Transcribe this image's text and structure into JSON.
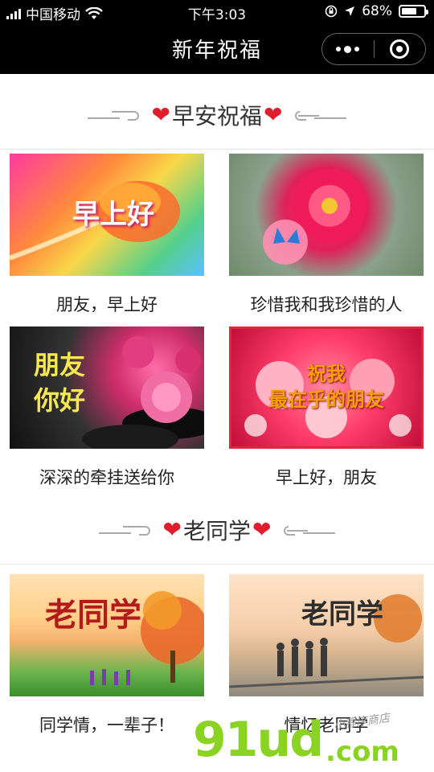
{
  "status_bar": {
    "carrier": "中国移动",
    "time": "下午3:03",
    "battery_percent": "68%",
    "battery_level": 0.68
  },
  "nav": {
    "title": "新年祝福"
  },
  "sections": [
    {
      "title": "早安祝福",
      "cards": [
        {
          "caption": "朋友，早上好",
          "image_text": "早上好"
        },
        {
          "caption": "珍惜我和我珍惜的人",
          "image_text": ""
        },
        {
          "caption": "深深的牵挂送给你",
          "image_text": "朋友\n你好"
        },
        {
          "caption": "早上好，朋友",
          "image_text": "祝我\n最在乎的朋友"
        }
      ]
    },
    {
      "title": "老同学",
      "cards": [
        {
          "caption": "同学情，一辈子！",
          "image_text": "老同学"
        },
        {
          "caption": "情忆老同学",
          "image_text": "老同学"
        }
      ]
    }
  ],
  "watermark": {
    "main": "91ud",
    "suffix": ".com",
    "sub": "小程序商店"
  },
  "colors": {
    "nav_background": "#000000",
    "heart": "#e01e2b",
    "watermark_green": "#8bd322"
  }
}
